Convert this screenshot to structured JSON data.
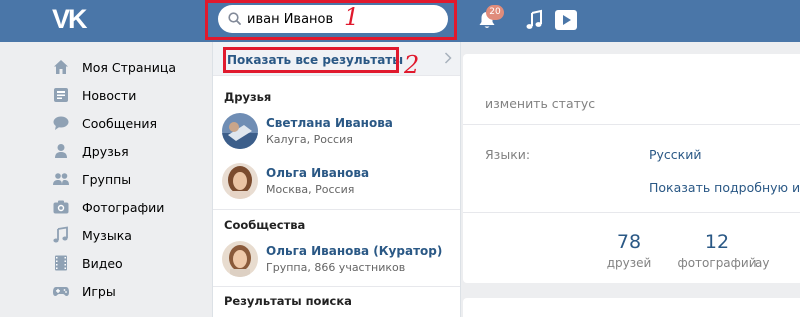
{
  "header": {
    "logo": "VK",
    "search_value": "иван Иванов",
    "notification_count": "20",
    "annotation_1": "1"
  },
  "sidebar": {
    "items": [
      {
        "label": "Моя Страница",
        "icon": "home-icon"
      },
      {
        "label": "Новости",
        "icon": "news-icon"
      },
      {
        "label": "Сообщения",
        "icon": "messages-icon"
      },
      {
        "label": "Друзья",
        "icon": "friends-icon"
      },
      {
        "label": "Группы",
        "icon": "groups-icon"
      },
      {
        "label": "Фотографии",
        "icon": "camera-icon"
      },
      {
        "label": "Музыка",
        "icon": "music-icon"
      },
      {
        "label": "Видео",
        "icon": "film-icon"
      },
      {
        "label": "Игры",
        "icon": "gamepad-icon"
      }
    ]
  },
  "dropdown": {
    "show_all": "Показать все результаты",
    "annotation_2": "2",
    "friends_title": "Друзья",
    "friends": [
      {
        "name": "Светлана Иванова",
        "sub": "Калуга, Россия"
      },
      {
        "name": "Ольга Иванова",
        "sub": "Москва, Россия"
      }
    ],
    "communities_title": "Сообщества",
    "communities": [
      {
        "name": "Ольга Иванова (Куратор)",
        "sub": "Группа, 866 участников"
      }
    ],
    "search_results_title": "Результаты поиска"
  },
  "profile": {
    "status": "изменить статус",
    "languages_label": "Языки:",
    "languages_value": "Русский",
    "more_info": "Показать подробную ин",
    "stats": [
      {
        "num": "78",
        "label": "друзей"
      },
      {
        "num": "12",
        "label": "фотографий"
      },
      {
        "num": "",
        "label": "ау"
      }
    ]
  },
  "colors": {
    "header": "#4a76a8",
    "link": "#2a5885",
    "annotation": "#e0192d",
    "background": "#edeef0"
  }
}
